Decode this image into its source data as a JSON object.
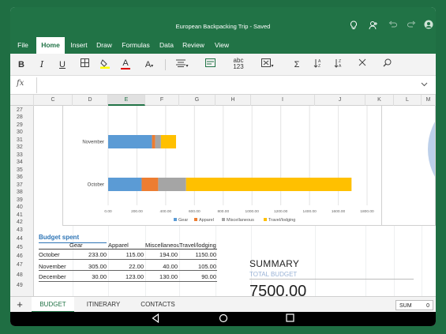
{
  "window": {
    "title": "European Backpacking Trip - Saved"
  },
  "titlebar_icons": [
    "lightbulb-icon",
    "share-person-icon",
    "undo-icon",
    "redo-icon",
    "account-icon"
  ],
  "ribbon": {
    "tabs": [
      {
        "label": "File"
      },
      {
        "label": "Home"
      },
      {
        "label": "Insert"
      },
      {
        "label": "Draw"
      },
      {
        "label": "Formulas"
      },
      {
        "label": "Data"
      },
      {
        "label": "Review"
      },
      {
        "label": "View"
      }
    ],
    "active_tab": "Home"
  },
  "toolbar": {
    "bold": "B",
    "italic": "I",
    "underline": "U",
    "font_color": "A",
    "font_size": "A",
    "number_format": "abc\n123",
    "sum": "Σ"
  },
  "formula_bar": {
    "fx": "fx",
    "value": ""
  },
  "columns": [
    "C",
    "D",
    "E",
    "F",
    "G",
    "H",
    "I",
    "J",
    "K",
    "L",
    "M"
  ],
  "selected_column": "E",
  "rows": [
    "27",
    "28",
    "29",
    "30",
    "31",
    "32",
    "33",
    "34",
    "35",
    "36",
    "37",
    "38",
    "39",
    "40",
    "41",
    "42",
    "43",
    "44",
    "45",
    "46",
    "47",
    "48",
    "49"
  ],
  "chart_data": {
    "type": "bar",
    "orientation": "horizontal",
    "stacked": true,
    "categories": [
      "November",
      "October"
    ],
    "series": [
      {
        "name": "Gear",
        "color": "#5b9bd5",
        "values": [
          305,
          233
        ]
      },
      {
        "name": "Apparel",
        "color": "#ed7d31",
        "values": [
          22,
          115
        ]
      },
      {
        "name": "Miscellaneous",
        "color": "#a5a5a5",
        "values": [
          40,
          194
        ]
      },
      {
        "name": "Travel/lodging",
        "color": "#ffc000",
        "values": [
          105,
          1150
        ]
      }
    ],
    "x_ticks": [
      "0.00",
      "200.00",
      "400.00",
      "600.00",
      "800.00",
      "1000.00",
      "1200.00",
      "1400.00",
      "1600.00",
      "1800.00"
    ],
    "xlim": [
      0,
      1800
    ],
    "grid": true,
    "legend_position": "bottom"
  },
  "budget_table": {
    "title": "Budget spent",
    "headers": [
      "Gear",
      "Apparel",
      "Miscellaneou",
      "Travel/lodging"
    ],
    "rows": [
      {
        "label": "October",
        "values": [
          "233.00",
          "115.00",
          "194.00",
          "1150.00"
        ]
      },
      {
        "label": "November",
        "values": [
          "305.00",
          "22.00",
          "40.00",
          "105.00"
        ]
      },
      {
        "label": "December",
        "values": [
          "30.00",
          "123.00",
          "130.00",
          "90.00"
        ]
      }
    ]
  },
  "summary": {
    "heading": "SUMMARY",
    "subheading": "TOTAL BUDGET",
    "total": "7500.00"
  },
  "sheets": {
    "add_label": "+",
    "tabs": [
      {
        "label": "BUDGET"
      },
      {
        "label": "ITINERARY"
      },
      {
        "label": "CONTACTS"
      }
    ],
    "active": "BUDGET"
  },
  "status": {
    "sum_label": "SUM",
    "sum_value": "0"
  }
}
